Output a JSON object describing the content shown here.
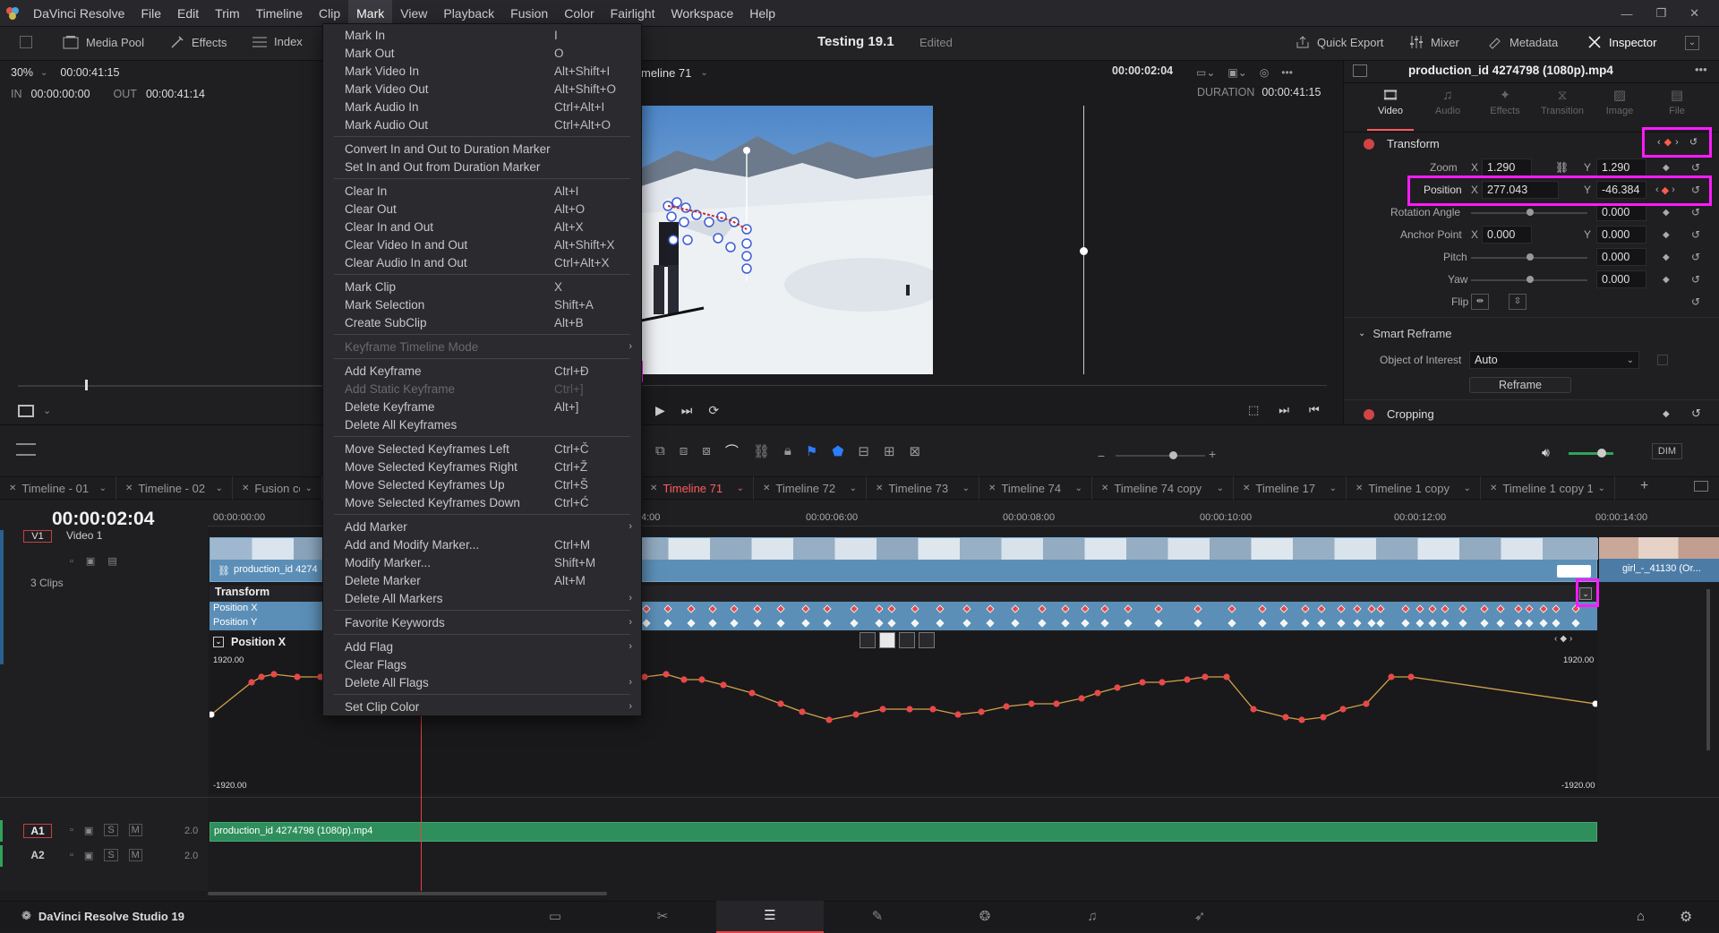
{
  "app": {
    "name": "DaVinci Resolve",
    "studio_label": "DaVinci Resolve Studio 19"
  },
  "menu": [
    "File",
    "Edit",
    "Trim",
    "Timeline",
    "Clip",
    "Mark",
    "View",
    "Playback",
    "Fusion",
    "Color",
    "Fairlight",
    "Workspace",
    "Help"
  ],
  "toolbar": {
    "media_pool": "Media Pool",
    "effects": "Effects",
    "index": "Index",
    "project_title": "Testing 19.1",
    "project_status": "Edited",
    "quick_export": "Quick Export",
    "mixer": "Mixer",
    "metadata": "Metadata",
    "inspector": "Inspector"
  },
  "source": {
    "zoom": "30%",
    "timecode": "00:00:41:15",
    "in_label": "IN",
    "in_value": "00:00:00:00",
    "out_label": "OUT",
    "out_value": "00:00:41:14"
  },
  "viewer": {
    "timeline_name": "meline 71",
    "timecode": "00:00:02:04",
    "duration_label": "DURATION",
    "duration_value": "00:00:41:15"
  },
  "mark_menu": {
    "groups": [
      [
        {
          "label": "Mark In",
          "sc": "I"
        },
        {
          "label": "Mark Out",
          "sc": "O"
        },
        {
          "label": "Mark Video In",
          "sc": "Alt+Shift+I"
        },
        {
          "label": "Mark Video Out",
          "sc": "Alt+Shift+O"
        },
        {
          "label": "Mark Audio In",
          "sc": "Ctrl+Alt+I"
        },
        {
          "label": "Mark Audio Out",
          "sc": "Ctrl+Alt+O"
        }
      ],
      [
        {
          "label": "Convert In and Out to Duration Marker",
          "sc": ""
        },
        {
          "label": "Set In and Out from Duration Marker",
          "sc": ""
        }
      ],
      [
        {
          "label": "Clear In",
          "sc": "Alt+I"
        },
        {
          "label": "Clear Out",
          "sc": "Alt+O"
        },
        {
          "label": "Clear In and Out",
          "sc": "Alt+X"
        },
        {
          "label": "Clear Video In and Out",
          "sc": "Alt+Shift+X"
        },
        {
          "label": "Clear Audio In and Out",
          "sc": "Ctrl+Alt+X"
        }
      ],
      [
        {
          "label": "Mark Clip",
          "sc": "X"
        },
        {
          "label": "Mark Selection",
          "sc": "Shift+A"
        },
        {
          "label": "Create SubClip",
          "sc": "Alt+B"
        }
      ],
      [
        {
          "label": "Keyframe Timeline Mode",
          "sc": "",
          "dis": true,
          "sub": true
        }
      ],
      [
        {
          "label": "Add Keyframe",
          "sc": "Ctrl+Đ"
        },
        {
          "label": "Add Static Keyframe",
          "sc": "Ctrl+]",
          "dis": true
        },
        {
          "label": "Delete Keyframe",
          "sc": "Alt+]"
        },
        {
          "label": "Delete All Keyframes",
          "sc": ""
        }
      ],
      [
        {
          "label": "Move Selected Keyframes Left",
          "sc": "Ctrl+Č"
        },
        {
          "label": "Move Selected Keyframes Right",
          "sc": "Ctrl+Ž"
        },
        {
          "label": "Move Selected Keyframes Up",
          "sc": "Ctrl+Š"
        },
        {
          "label": "Move Selected Keyframes Down",
          "sc": "Ctrl+Ć"
        }
      ],
      [
        {
          "label": "Add Marker",
          "sc": "",
          "sub": true
        },
        {
          "label": "Add and Modify Marker...",
          "sc": "Ctrl+M"
        },
        {
          "label": "Modify Marker...",
          "sc": "Shift+M"
        },
        {
          "label": "Delete Marker",
          "sc": "Alt+M"
        },
        {
          "label": "Delete All Markers",
          "sc": "",
          "sub": true
        }
      ],
      [
        {
          "label": "Favorite Keywords",
          "sc": "",
          "sub": true
        }
      ],
      [
        {
          "label": "Add Flag",
          "sc": "",
          "sub": true
        },
        {
          "label": "Clear Flags",
          "sc": ""
        },
        {
          "label": "Delete All Flags",
          "sc": "",
          "sub": true
        }
      ],
      [
        {
          "label": "Set Clip Color",
          "sc": "",
          "sub": true
        }
      ]
    ]
  },
  "inspector": {
    "clip_name": "production_id 4274798 (1080p).mp4",
    "tabs": [
      "Video",
      "Audio",
      "Effects",
      "Transition",
      "Image",
      "File"
    ],
    "transform_label": "Transform",
    "zoom": {
      "label": "Zoom",
      "x": "1.290",
      "y": "1.290"
    },
    "position": {
      "label": "Position",
      "x": "277.043",
      "y": "-46.384"
    },
    "rotation": {
      "label": "Rotation Angle",
      "value": "0.000"
    },
    "anchor": {
      "label": "Anchor Point",
      "x": "0.000",
      "y": "0.000"
    },
    "pitch": {
      "label": "Pitch",
      "value": "0.000"
    },
    "yaw": {
      "label": "Yaw",
      "value": "0.000"
    },
    "flip": {
      "label": "Flip"
    },
    "smart_reframe": "Smart Reframe",
    "object_label": "Object of Interest",
    "object_value": "Auto",
    "reframe_btn": "Reframe",
    "cropping": "Cropping",
    "x_lbl": "X",
    "y_lbl": "Y"
  },
  "timeline_tabs": [
    "Timeline - 01",
    "Timeline - 02",
    "Fusion com",
    "Timeline 71",
    "Timeline 72",
    "Timeline 73",
    "Timeline 74",
    "Timeline 74 copy",
    "Timeline 17",
    "Timeline 1 copy",
    "Timeline 1 copy 1"
  ],
  "timeline": {
    "timecode": "00:00:02:04",
    "ruler": [
      "00:00:00:00",
      "00:00:06:00",
      "00:00:08:00",
      "00:00:10:00",
      "00:00:12:00",
      "00:00:14:00"
    ],
    "ruler_partial": "4:00",
    "v1_label": "V1",
    "video_label": "Video 1",
    "clips": "3 Clips",
    "clip_name": "production_id 4274",
    "clip2_name": "girl_-_41130 (Or...",
    "transform": "Transform",
    "pos_x": "Position X",
    "pos_y": "Position Y",
    "curve_label": "Position X",
    "curve_top": "1920.00",
    "curve_bottom": "-1920.00",
    "a1": "A1",
    "a2": "A2",
    "a1_level": "2.0",
    "a2_level": "2.0",
    "audio_clip": "production_id 4274798 (1080p).mp4",
    "dim": "DIM"
  }
}
